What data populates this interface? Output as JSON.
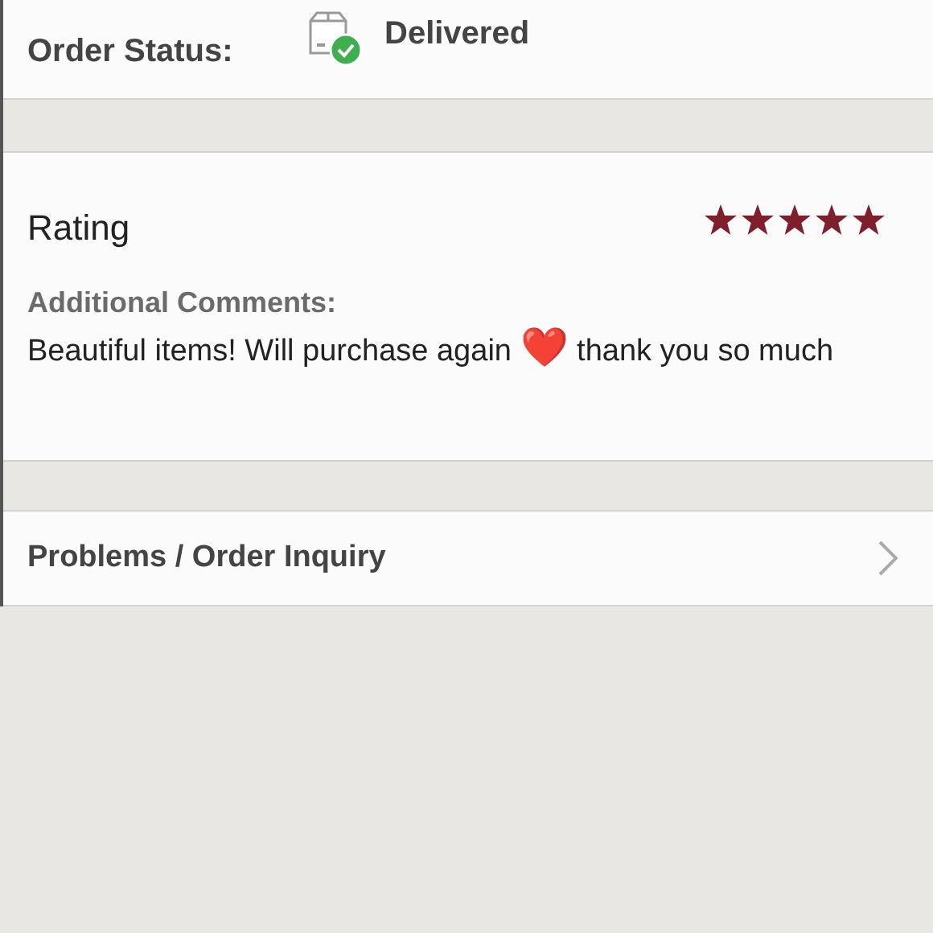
{
  "order_status": {
    "label": "Order Status:",
    "value": "Delivered"
  },
  "rating": {
    "title": "Rating",
    "stars": 5
  },
  "comments": {
    "label": "Additional Comments:",
    "text": "Beautiful items! Will purchase again ❤️ thank you so much"
  },
  "inquiry": {
    "label": "Problems / Order Inquiry"
  }
}
